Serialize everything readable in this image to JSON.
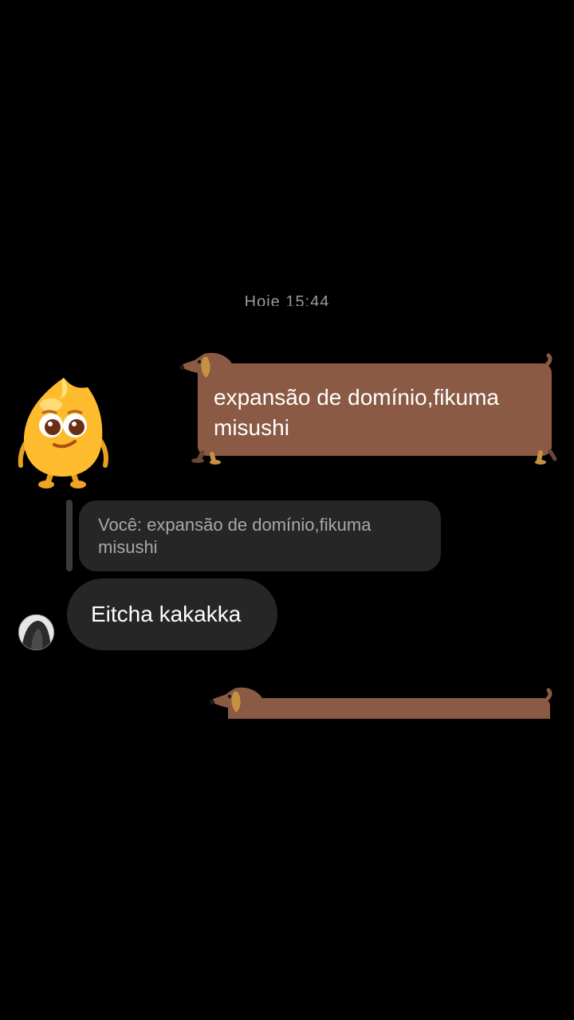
{
  "conversation": {
    "timestamp": "Hoje 15:44",
    "outgoing_message": "expansão de domínio,fikuma misushi",
    "reply_preview": "Você: expansão de domínio,fikuma misushi",
    "incoming_message": "Eitcha kakakka"
  },
  "theme": {
    "background": "#000000",
    "dog_bubble_color": "#8b5a45",
    "incoming_bubble_color": "#262626",
    "reply_text_color": "#a8a8a8"
  },
  "icons": {
    "sticker": "yellow-flame-mascot-sticker",
    "bubble_decoration": "dachshund-icon"
  }
}
